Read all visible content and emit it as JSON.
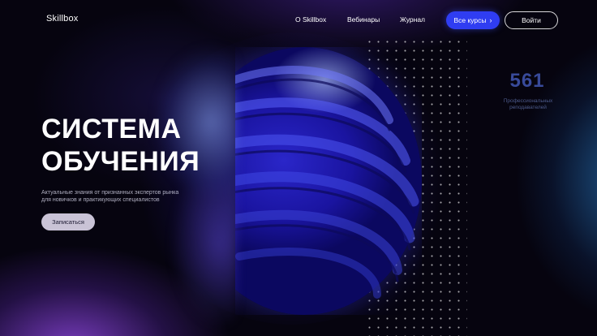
{
  "header": {
    "logo": "Skillbox",
    "nav": {
      "about": "О Skillbox",
      "webinars": "Вебинары",
      "journal": "Журнал"
    },
    "courses_button": "Все курсы",
    "courses_button_icon": "chevron-right-icon",
    "login_button": "Войти"
  },
  "hero": {
    "title_line1": "СИСТЕМА",
    "title_line2": "ОБУЧЕНИЯ",
    "subtitle_line1": "Актуальные знания от признанных экспертов рынка",
    "subtitle_line2": "для новичков и практикующих специалистов",
    "signup_button": "Записаться"
  },
  "stat": {
    "number": "561",
    "label_line1": "Профессиональных",
    "label_line2": "реподавателей"
  },
  "colors": {
    "accent_blue": "#2f3df2",
    "background": "#06040f",
    "stat_number": "#384a9a"
  }
}
